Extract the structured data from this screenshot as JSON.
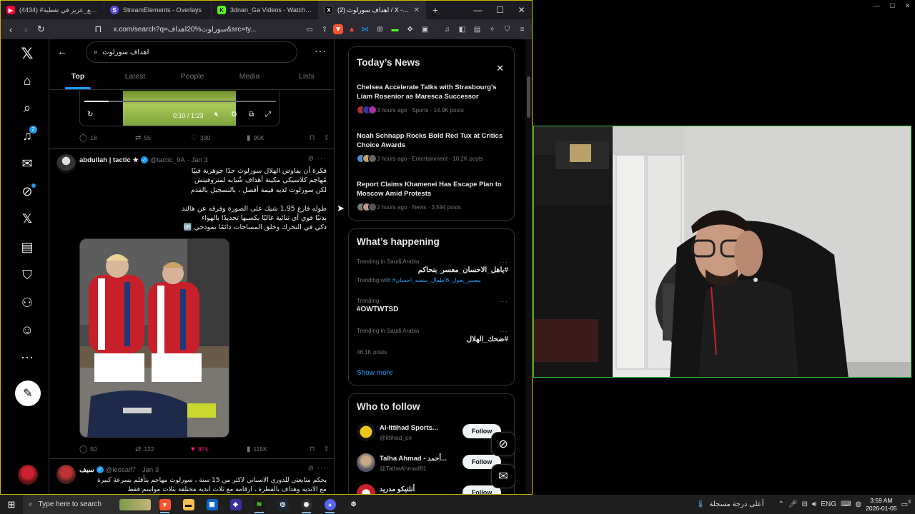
{
  "browser": {
    "tabs": [
      {
        "label": "(4434) #المايك_مع_عزيز في تغطية...",
        "icon": "youtube-icon",
        "color": "#ff0033",
        "active": false
      },
      {
        "label": "StreamElements - Overlays",
        "icon": "streamelements-icon",
        "color": "#5b4ee0",
        "active": false
      },
      {
        "label": "3dnan_Ga Videos - Watch On...",
        "icon": "kick-icon",
        "color": "#53fc18",
        "active": false
      },
      {
        "label": "(2) اهداف سورلوث / X - Search",
        "icon": "x-icon",
        "color": "#000000",
        "active": true
      }
    ],
    "url": "x.com/search?q=سورلوث%20اهداف&src=ty..."
  },
  "x": {
    "search_query": "اهداف سورلوث",
    "tabs": [
      "Top",
      "Latest",
      "People",
      "Media",
      "Lists"
    ],
    "notifications_badge": "2",
    "video": {
      "time": "0:10 / 1:23"
    },
    "tweet0_actions": {
      "replies": "18",
      "reposts": "55",
      "likes": "330",
      "views": "95K"
    },
    "tweet1": {
      "name": "abdullah | tactic ★",
      "handle": "@tactic_9A",
      "date": "· Jan 3",
      "lines": [
        "فكرة أن يفاوض الهلال سورلوث جدًا جوهرية فنيًا",
        "مُهاجم كلاسيكي مكينة أهداف شُبابه لمتروفيتش",
        "لكن سورلوث لديه قيمة أفضل ، بالتسجيل بالقدم",
        "",
        "طوله فارع 1,95 شيك على الصورة وفرقه عن هالند",
        "بدنيًا قوي أي ثنائية غالبًا يكسبها تحديدًا بالهواء",
        "ذكي في التحرك وخلق المساحات دائمًا نموذجي 🆙"
      ],
      "replies": "50",
      "reposts": "122",
      "likes": "874",
      "views": "115K"
    },
    "tweet2": {
      "name": "سيف",
      "handle": "@leosaif7",
      "date": "· Jan 3",
      "lines": [
        "يحكم متابعتي للدوري الاسباني لاكثر من 15 سنة ، سورلوث مهاجم يتأقلم بسرعة كبيرة",
        "مع الاندية وهداف بالفطرة ، ارقامه مع ثلاث اندية مختلفة بثلاث مواسم فقط"
      ]
    },
    "news": {
      "title": "Today’s News",
      "items": [
        {
          "headline": "Chelsea Accelerate Talks with Strasbourg's Liam Rosenior as Maresca Successor",
          "meta": "3 hours ago · Sports · 14.9K posts"
        },
        {
          "headline": "Noah Schnapp Rocks Bold Red Tux at Critics Choice Awards",
          "meta": "3 hours ago · Entertainment · 10.2K posts"
        },
        {
          "headline": "Report Claims Khamenei Has Escape Plan to Moscow Amid Protests",
          "meta": "2 hours ago · News · 3,594 posts"
        }
      ]
    },
    "happening": {
      "title": "What’s happening",
      "trends": [
        {
          "context": "Trending in Saudi Arabia",
          "name": "#ياهل_الاحسان_معسر_بنحاكم",
          "with_label": "Trending with",
          "with_tag": "#معسر_يعول_6اطفال_منصه_احسان"
        },
        {
          "context": "Trending",
          "name": "#OWTWTSD"
        },
        {
          "context": "Trending in Saudi Arabia",
          "name": "#ضحك_الهلال",
          "posts": "46.1K posts"
        }
      ],
      "show_more": "Show more"
    },
    "who_to_follow": {
      "title": "Who to follow",
      "accounts": [
        {
          "name": "Al-Ittihad Sports...",
          "handle": "@ittihad_cn",
          "button": "Follow"
        },
        {
          "name": "Talha Ahmad - أحمد...",
          "handle": "@TalhaAhmad81",
          "button": "Follow"
        },
        {
          "name": "أتلتيكو مدريد",
          "handle": "",
          "button": "Follow"
        }
      ]
    }
  },
  "taskbar": {
    "search_placeholder": "Type here to search",
    "weather_text": "أعلى درجة مسجلة",
    "language": "ENG",
    "time": "3:59 AM",
    "date": "2026-01-05",
    "notification_count": "3"
  }
}
